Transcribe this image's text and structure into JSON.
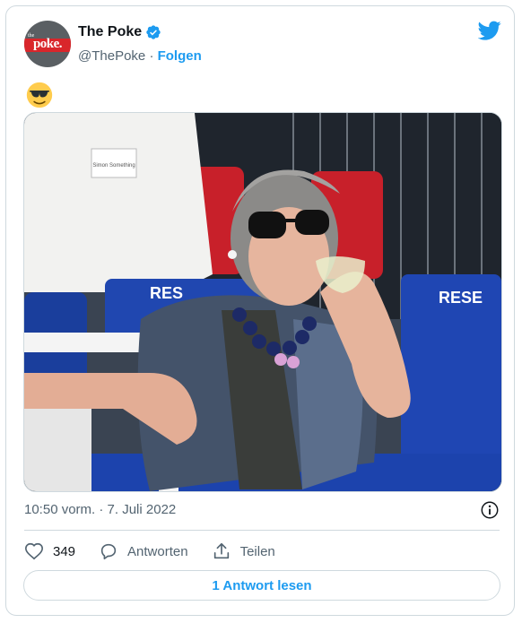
{
  "tweet": {
    "author_name": "The Poke",
    "author_handle": "@ThePoke",
    "separator": "·",
    "follow_label": "Folgen",
    "avatar_logo_text": "poke.",
    "avatar_small_text": "the",
    "emoji": "😎",
    "timestamp": "10:50 vorm. · 7. Juli 2022",
    "likes_count": "349",
    "reply_label": "Antworten",
    "share_label": "Teilen",
    "read_replies_label": "1 Antwort lesen",
    "photo_sign_left": "RES",
    "photo_sign_right": "RESE",
    "photo_badge_text": "Simon Something"
  },
  "colors": {
    "accent": "#1d9bf0",
    "text_primary": "#0f1419",
    "text_secondary": "#536471",
    "border": "#cfd9de",
    "logo_red": "#d9262b"
  },
  "icons": {
    "verified": "verified-badge-icon",
    "platform": "twitter-bird-icon",
    "info": "info-icon",
    "like": "heart-icon",
    "reply": "speech-bubble-icon",
    "share": "share-upload-icon"
  }
}
